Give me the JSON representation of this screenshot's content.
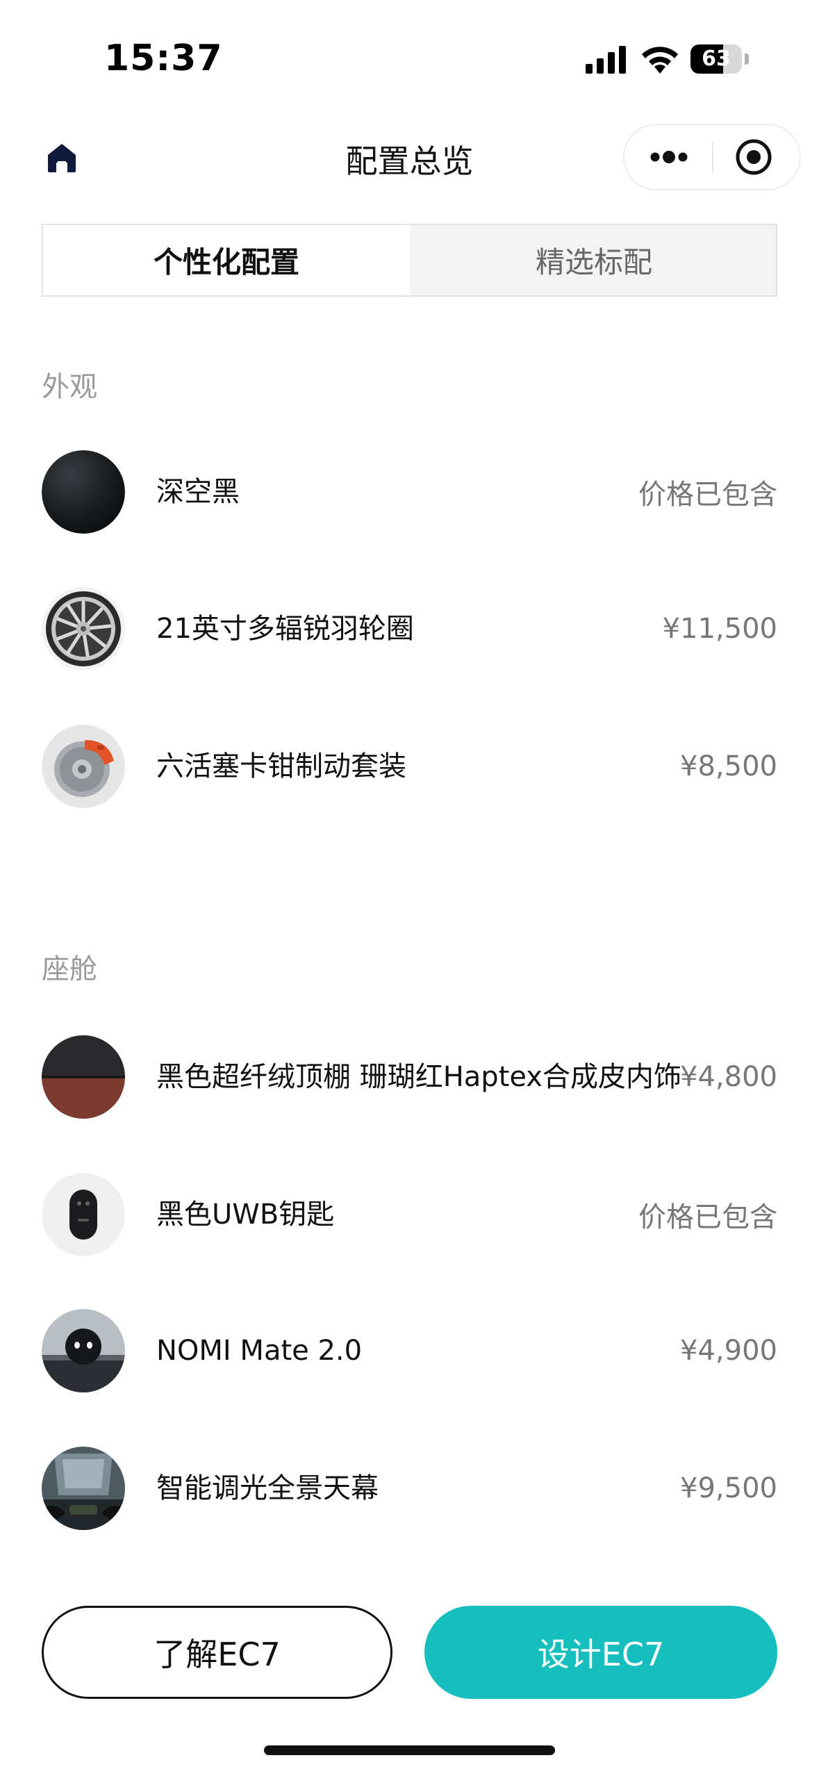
{
  "status_bar": {
    "time": "15:37",
    "battery_level": "63",
    "battery_fraction": 0.63
  },
  "nav": {
    "title": "配置总览"
  },
  "tabs": [
    {
      "label": "个性化配置",
      "active": true
    },
    {
      "label": "精选标配",
      "active": false
    }
  ],
  "sections": {
    "exterior": {
      "label": "外观",
      "items": [
        {
          "name": "深空黑",
          "price": "价格已包含",
          "icon": "black-paint-swatch"
        },
        {
          "name": "21英寸多辐锐羽轮圈",
          "price": "¥11,500",
          "icon": "wheel-rim"
        },
        {
          "name": "六活塞卡钳制动套装",
          "price": "¥8,500",
          "icon": "brake-caliper"
        }
      ]
    },
    "cabin": {
      "label": "座舱",
      "items": [
        {
          "name": "黑色超纤绒顶棚 珊瑚红Haptex合成皮内饰",
          "price": "¥4,800",
          "icon": "interior-swatch"
        },
        {
          "name": "黑色UWB钥匙",
          "price": "价格已包含",
          "icon": "uwb-key"
        },
        {
          "name": "NOMI Mate 2.0",
          "price": "¥4,900",
          "icon": "nomi-robot"
        },
        {
          "name": "智能调光全景天幕",
          "price": "¥9,500",
          "icon": "panoramic-roof"
        }
      ]
    }
  },
  "actions": {
    "learn_label": "了解EC7",
    "design_label": "设计EC7"
  },
  "colors": {
    "accent": "#15bfbd",
    "text_primary": "#111111",
    "text_secondary": "#777777",
    "section_label": "#9a9a9a"
  }
}
